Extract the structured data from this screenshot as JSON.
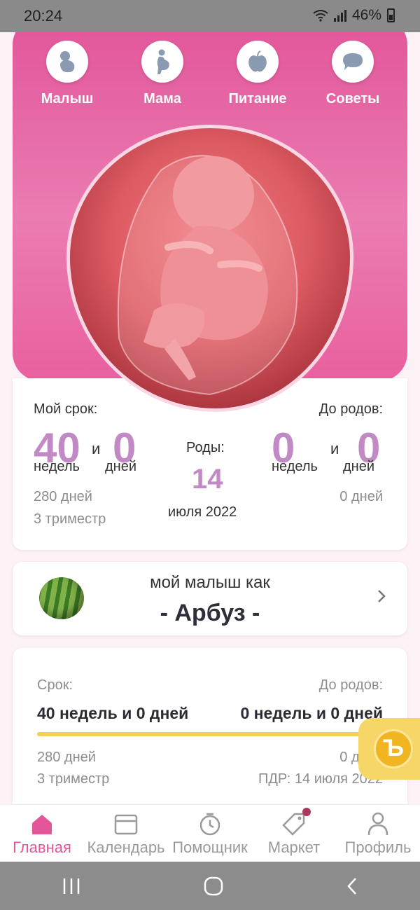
{
  "status_bar": {
    "time": "20:24",
    "battery": "46%"
  },
  "top_nav": {
    "items": [
      {
        "label": "Малыш",
        "icon": "baby-icon"
      },
      {
        "label": "Мама",
        "icon": "pregnant-mother-icon"
      },
      {
        "label": "Питание",
        "icon": "apple-icon"
      },
      {
        "label": "Советы",
        "icon": "chat-bubble-icon"
      }
    ]
  },
  "stats": {
    "my_term_label": "Мой срок:",
    "weeks": "40",
    "and1": "и",
    "days": "0",
    "weeks_unit": "недель",
    "days_unit": "дней",
    "total_days": "280 дней",
    "trimester": "3 триместр",
    "birth_label": "Роды:",
    "birth_day": "14",
    "birth_month": "июля 2022",
    "until_label": "До родов:",
    "until_weeks": "0",
    "and2": "и",
    "until_days": "0",
    "until_weeks_unit": "недель",
    "until_days_unit": "дней",
    "until_total": "0 дней"
  },
  "fruit": {
    "subtitle": "мой малыш как",
    "name": "- Арбуз -"
  },
  "progress_card": {
    "term_label": "Срок:",
    "until_label": "До родов:",
    "term_value": "40 недель и 0 дней",
    "until_value": "0 недель и 0 дней",
    "progress": 1.0,
    "total_days": "280 дней",
    "until_days": "0 дней",
    "trimester": "3 триместр",
    "due_date": "ПДР: 14 июля 2022"
  },
  "bottom_nav": {
    "tabs": [
      {
        "label": "Главная",
        "icon": "home-icon",
        "active": true
      },
      {
        "label": "Календарь",
        "icon": "calendar-icon"
      },
      {
        "label": "Помощник",
        "icon": "timer-icon"
      },
      {
        "label": "Маркет",
        "icon": "tag-icon"
      },
      {
        "label": "Профиль",
        "icon": "profile-icon"
      }
    ]
  },
  "colors": {
    "accent": "#e5559a",
    "number": "#c28ac4",
    "progress": "#f3cf55"
  }
}
